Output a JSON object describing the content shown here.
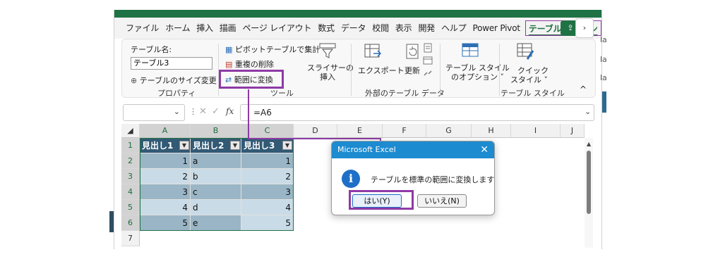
{
  "ribbon_tabs": [
    "ファイル",
    "ホーム",
    "挿入",
    "描画",
    "ページ レイアウト",
    "数式",
    "データ",
    "校閲",
    "表示",
    "開発",
    "ヘルプ",
    "Power Pivot",
    "テーブル デザイン"
  ],
  "ribbon": {
    "table_name_label": "テーブル名:",
    "table_name_value": "テーブル3",
    "resize_table": "テーブルのサイズ変更",
    "properties_group": "プロパティ",
    "pivot_summarize": "ピボットテーブルで集計",
    "remove_duplicates": "重複の削除",
    "convert_to_range": "範囲に変換",
    "tools_group": "ツール",
    "insert_slicer_line1": "スライサーの",
    "insert_slicer_line2": "挿入",
    "export": "エクスポート",
    "refresh": "更新",
    "external_group": "外部のテーブル データ",
    "style_options_line1": "テーブル スタイル",
    "style_options_line2": "のオプション",
    "quick_styles_line1": "クイック",
    "quick_styles_line2": "スタイル",
    "styles_group": "テーブル スタイル"
  },
  "formula_bar": {
    "formula": "=A6",
    "fx": "fx"
  },
  "grid": {
    "columns": [
      "A",
      "B",
      "C",
      "D",
      "E",
      "F",
      "G",
      "H",
      "I",
      "J"
    ],
    "rows": [
      "1",
      "2",
      "3",
      "4",
      "5",
      "6",
      "7"
    ],
    "headers": [
      "見出し1",
      "見出し2",
      "見出し3"
    ],
    "data": [
      [
        "1",
        "a",
        "1"
      ],
      [
        "2",
        "b",
        "2"
      ],
      [
        "3",
        "c",
        "3"
      ],
      [
        "4",
        "d",
        "4"
      ],
      [
        "5",
        "e",
        "5"
      ]
    ]
  },
  "dialog": {
    "title": "Microsoft Excel",
    "message": "テーブルを標準の範囲に変換しますか?",
    "yes_label": "はい(Y)",
    "no_label": "いいえ(N)"
  },
  "colors": {
    "excel_green": "#1f7244",
    "highlight": "#8e3aa6",
    "table_header": "#325a75",
    "table_band": "#9ab6c6",
    "dialog_title": "#1c8bd0"
  }
}
